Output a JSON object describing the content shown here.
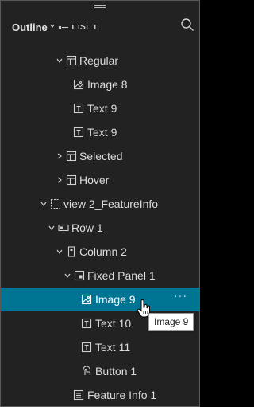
{
  "panel": {
    "title": "Outline"
  },
  "tree": [
    {
      "label": "List 1",
      "icon": "list-icon",
      "caret": "down"
    },
    {
      "label": "Regular",
      "icon": "state-icon",
      "caret": "down"
    },
    {
      "label": "Image 8",
      "icon": "image-icon",
      "caret": ""
    },
    {
      "label": "Text 9",
      "icon": "text-icon",
      "caret": ""
    },
    {
      "label": "Text 9",
      "icon": "text-icon",
      "caret": ""
    },
    {
      "label": "Selected",
      "icon": "state-icon",
      "caret": "right"
    },
    {
      "label": "Hover",
      "icon": "state-icon",
      "caret": "right"
    },
    {
      "label": "view 2_FeatureInfo",
      "icon": "view-icon",
      "caret": "down"
    },
    {
      "label": "Row 1",
      "icon": "row-icon",
      "caret": "down"
    },
    {
      "label": "Column 2",
      "icon": "column-icon",
      "caret": "down"
    },
    {
      "label": "Fixed Panel 1",
      "icon": "fixed-panel-icon",
      "caret": "down"
    },
    {
      "label": "Image 9",
      "icon": "image-icon",
      "caret": "",
      "selected": true
    },
    {
      "label": "Text 10",
      "icon": "text-icon",
      "caret": ""
    },
    {
      "label": "Text 11",
      "icon": "text-icon",
      "caret": ""
    },
    {
      "label": "Button 1",
      "icon": "button-icon",
      "caret": ""
    },
    {
      "label": "Feature Info 1",
      "icon": "feature-info-icon",
      "caret": ""
    }
  ],
  "more_menu": "···",
  "tooltip": {
    "text": "Image 9"
  },
  "colors": {
    "background": "#222222",
    "selected_row": "#007493",
    "text": "#dcdcdc"
  }
}
